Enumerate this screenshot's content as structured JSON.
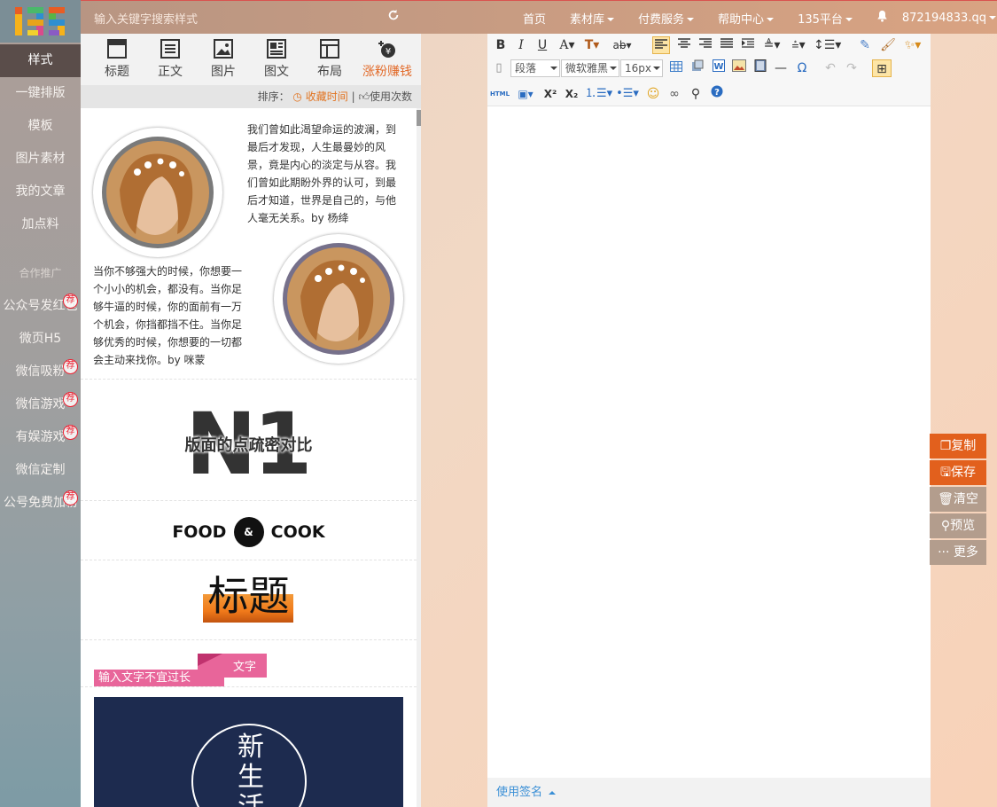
{
  "app": {
    "logo_text": "135",
    "search_placeholder": "输入关键字搜索样式"
  },
  "nav": {
    "items": [
      {
        "label": "首页",
        "dropdown": false
      },
      {
        "label": "素材库",
        "dropdown": true
      },
      {
        "label": "付费服务",
        "dropdown": true
      },
      {
        "label": "帮助中心",
        "dropdown": true
      },
      {
        "label": "135平台",
        "dropdown": true
      }
    ],
    "user": "872194833.qq"
  },
  "sidebar": {
    "items": [
      {
        "label": "样式",
        "active": true
      },
      {
        "label": "一键排版",
        "active": false
      },
      {
        "label": "模板",
        "active": false
      },
      {
        "label": "图片素材",
        "active": false
      },
      {
        "label": "我的文章",
        "active": false
      },
      {
        "label": "加点料",
        "active": false
      }
    ],
    "section_label": "合作推广",
    "promo_items": [
      {
        "label": "公众号发红包",
        "badge": "荐"
      },
      {
        "label": "微页H5",
        "badge": ""
      },
      {
        "label": "微信吸粉",
        "badge": "荐"
      },
      {
        "label": "微信游戏",
        "badge": "荐"
      },
      {
        "label": "有娱游戏",
        "badge": "荐"
      },
      {
        "label": "微信定制",
        "badge": ""
      },
      {
        "label": "公号免费加粉",
        "badge": "荐"
      }
    ]
  },
  "panel": {
    "tools": [
      {
        "label": "标题",
        "icon": "title-icon"
      },
      {
        "label": "正文",
        "icon": "text-icon"
      },
      {
        "label": "图片",
        "icon": "image-icon"
      },
      {
        "label": "图文",
        "icon": "image-text-icon"
      },
      {
        "label": "布局",
        "icon": "layout-icon"
      },
      {
        "label": "涨粉赚钱",
        "icon": "money-icon"
      }
    ],
    "sort": {
      "label": "排序：",
      "option_favorites": "收藏时间",
      "separator": "|",
      "option_usage": "使用次数"
    },
    "cards": {
      "quote1": "我们曾如此渴望命运的波澜，到最后才发现，人生最曼妙的风景，竟是内心的淡定与从容。我们曾如此期盼外界的认可，到最后才知道，世界是自己的，与他人毫无关系。by 杨绛",
      "quote2": "当你不够强大的时候，你想要一个小小的机会，都没有。当你足够牛逼的时候，你的面前有一万个机会，你挡都挡不住。当你足够优秀的时候，你想要的一切都会主动来找你。by 咪蒙",
      "n1_big": "N1",
      "n1_caption": "版面的点疏密对比",
      "food_left": "FOOD",
      "food_amp": "&",
      "food_right": "COOK",
      "title_sample": "标题",
      "pink_tag": "文字",
      "pink_banner": "输入文字不宜过长",
      "vertical_title": "新生活"
    }
  },
  "editor": {
    "paragraph_select": "段落",
    "font_select": "微软雅黑",
    "size_select": "16px",
    "html_label": "HTML",
    "signature_label": "使用签名"
  },
  "actions": [
    {
      "label": "复制",
      "icon": "copy-icon",
      "style": "orange"
    },
    {
      "label": "保存",
      "icon": "save-icon",
      "style": "orange"
    },
    {
      "label": "清空",
      "icon": "trash-icon",
      "style": "grey"
    },
    {
      "label": "预览",
      "icon": "search-icon",
      "style": "grey"
    },
    {
      "label": "更多",
      "icon": "more-icon",
      "style": "grey"
    }
  ],
  "colors": {
    "accent_orange": "#e2601d",
    "hot_text": "#e26a29",
    "sidebar_active": "#5a4d4a",
    "badge_red": "#e22233",
    "link_blue": "#3a8fd6"
  }
}
